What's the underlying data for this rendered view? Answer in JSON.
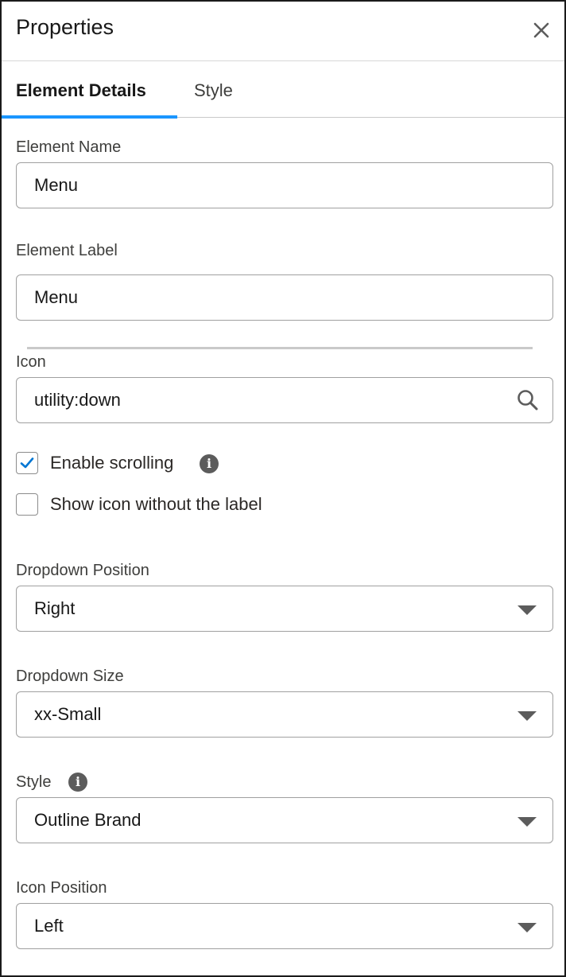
{
  "header": {
    "title": "Properties",
    "close_icon": "close-icon"
  },
  "tabs": [
    {
      "label": "Element Details",
      "active": true
    },
    {
      "label": "Style",
      "active": false
    }
  ],
  "accent_color": "#1b96ff",
  "fields": {
    "element_name": {
      "label": "Element Name",
      "value": "Menu"
    },
    "element_label": {
      "label": "Element Label",
      "value": "Menu"
    },
    "icon": {
      "label": "Icon",
      "value": "utility:down",
      "icon": "search-icon"
    }
  },
  "checkboxes": {
    "enable_scrolling": {
      "label": "Enable scrolling",
      "checked": true,
      "info_icon": "info-icon"
    },
    "show_icon_only": {
      "label": "Show icon without the label",
      "checked": false
    }
  },
  "selects": {
    "dropdown_position": {
      "label": "Dropdown Position",
      "value": "Right"
    },
    "dropdown_size": {
      "label": "Dropdown Size",
      "value": "xx-Small"
    },
    "style": {
      "label": "Style",
      "value": "Outline Brand",
      "info_icon": "info-icon"
    },
    "icon_position": {
      "label": "Icon Position",
      "value": "Left"
    }
  }
}
